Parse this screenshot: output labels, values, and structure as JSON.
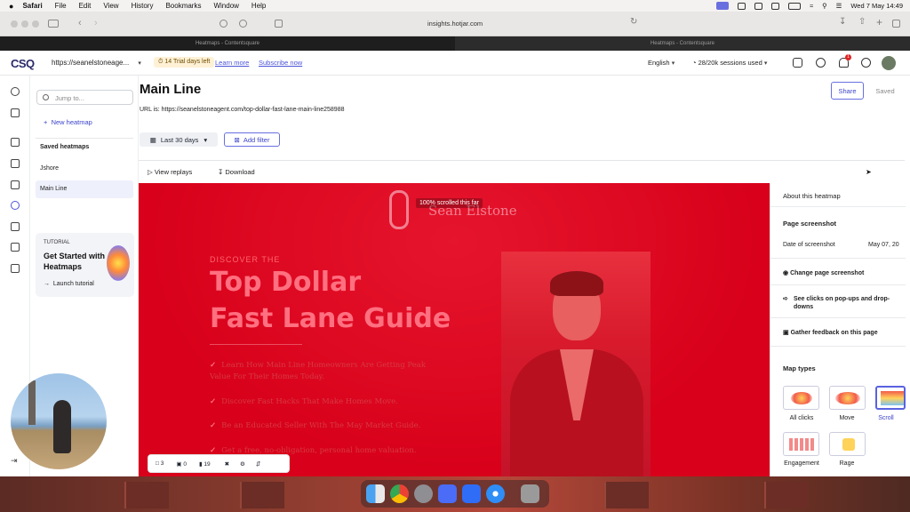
{
  "mac": {
    "menu": [
      "Safari",
      "File",
      "Edit",
      "View",
      "History",
      "Bookmarks",
      "Window",
      "Help"
    ],
    "clock": "Wed 7 May  14:49"
  },
  "browser": {
    "address": "insights.hotjar.com",
    "tabs": [
      "Heatmaps - Contentsquare",
      "Heatmaps - Contentsquare"
    ]
  },
  "topnav": {
    "logo": "CSQ",
    "site_url": "https://seanelstoneage...",
    "trial_badge": "14 Trial days left",
    "learn_more": "Learn more",
    "subscribe": "Subscribe now",
    "language": "English",
    "sessions": "28/20k sessions used",
    "notification_count": "1"
  },
  "sidebar": {
    "search_placeholder": "Jump to...",
    "new_heatmap": "New heatmap",
    "saved_heading": "Saved heatmaps",
    "items": [
      "Jshore",
      "Main Line"
    ],
    "tutorial": {
      "label": "TUTORIAL",
      "title": "Get Started with Heatmaps",
      "launch": "Launch tutorial"
    }
  },
  "main": {
    "title": "Main Line",
    "url_line": "URL is: https://seanelstoneagent.com/top-dollar-fast-lane-main-line258988",
    "date_filter": "Last 30 days",
    "add_filter": "Add filter",
    "share": "Share",
    "saved": "Saved",
    "view_replays": "View replays",
    "download": "Download"
  },
  "heatmap": {
    "scroll_tooltip": "100% scrolled this far",
    "brand": "Sean Elstone",
    "discover": "DISCOVER THE",
    "headline_1": "Top Dollar",
    "headline_2": "Fast Lane Guide",
    "bullets": [
      "Learn How Main Line Homeowners Are Getting Peak Value For Their Homes Today.",
      "Discover Fast Hacks That Make Homes Move.",
      "Be an Educated Seller With The May Market Guide.",
      "Get a free, no-obligation, personal home valuation."
    ],
    "colors": {
      "overlay": "#d8001a",
      "accent": "#4b54d6"
    }
  },
  "panel": {
    "about": "About this heatmap",
    "page_screenshot": "Page screenshot",
    "date_label": "Date of screenshot",
    "date_value": "May 07, 20",
    "change_screenshot": "Change page screenshot",
    "see_clicks": "See clicks on pop-ups and drop-downs",
    "gather_feedback": "Gather feedback on this page",
    "map_types_heading": "Map types",
    "map_types": [
      "All clicks",
      "Move",
      "Scroll",
      "Engagement",
      "Rage"
    ]
  },
  "bottombar": {
    "desktop_count": "3",
    "tablet_count": "0",
    "mobile_count": "19"
  }
}
